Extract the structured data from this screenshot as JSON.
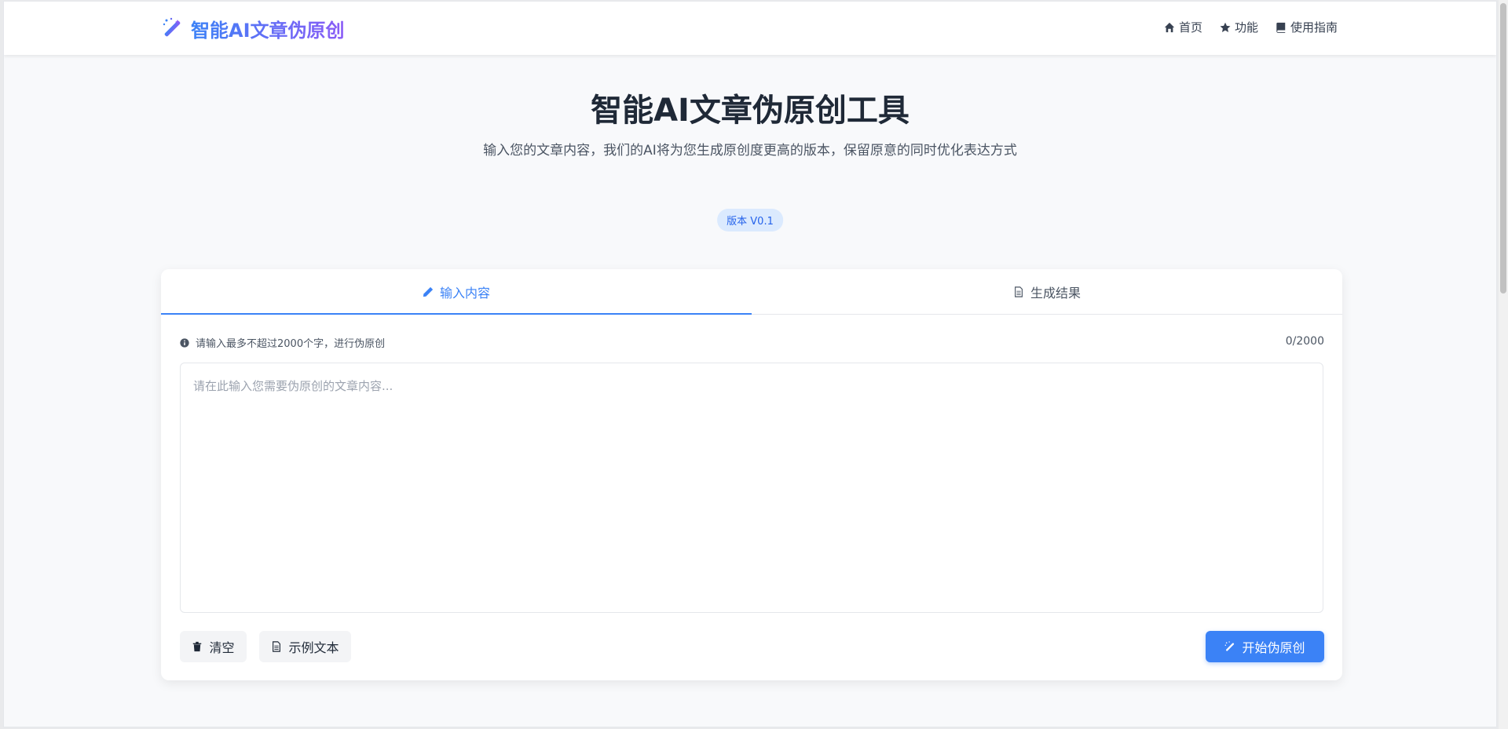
{
  "header": {
    "brand_title": "智能AI文章伪原创",
    "nav": [
      {
        "label": "首页",
        "icon": "home-icon"
      },
      {
        "label": "功能",
        "icon": "star-icon"
      },
      {
        "label": "使用指南",
        "icon": "book-icon"
      }
    ]
  },
  "hero": {
    "title": "智能AI文章伪原创工具",
    "subtitle": "输入您的文章内容，我们的AI将为您生成原创度更高的版本，保留原意的同时优化表达方式",
    "version_badge": "版本 V0.1"
  },
  "card": {
    "tabs": [
      {
        "label": "输入内容",
        "icon": "pencil-icon",
        "active": true
      },
      {
        "label": "生成结果",
        "icon": "document-icon",
        "active": false
      }
    ],
    "hint": "请输入最多不超过2000个字，进行伪原创",
    "counter": "0/2000",
    "textarea": {
      "value": "",
      "placeholder": "请在此输入您需要伪原创的文章内容..."
    },
    "buttons": {
      "clear": "清空",
      "sample": "示例文本",
      "start": "开始伪原创"
    }
  },
  "colors": {
    "accent": "#3b82f6",
    "gradient_end": "#8b5cf6",
    "background": "#f8f9fb"
  }
}
